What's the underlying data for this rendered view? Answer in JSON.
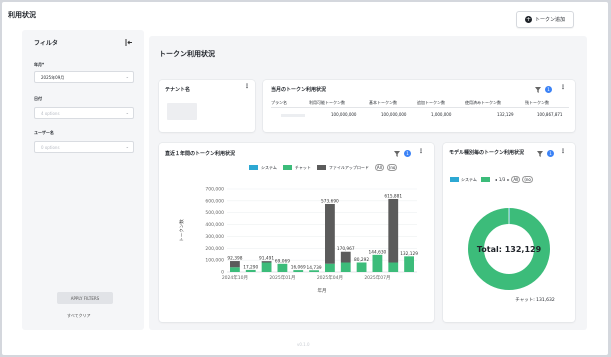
{
  "app": {
    "title": "利用状況",
    "add_token_label": "トークン追加",
    "version": "v0.1.0"
  },
  "filter": {
    "title": "フィルタ",
    "year_month_label": "年月*",
    "year_month_value": "2025年09月",
    "date_label": "日付",
    "date_placeholder": "4 options",
    "user_label": "ユーザー名",
    "user_placeholder": "0 options",
    "apply_label": "APPLY FILTERS",
    "clear_label": "すべてクリア"
  },
  "main": {
    "section_title": "トークン利用状況"
  },
  "tenant": {
    "title": "テナント名"
  },
  "monthly": {
    "title": "当月のトークン利用状況",
    "badge": "1",
    "headers": [
      "プラン名",
      "利用可能トークン数",
      "基本トークン数",
      "追加トークン数",
      "使用済みトークン数",
      "残トークン数"
    ],
    "row": [
      "",
      "100,000,000",
      "100,000,000",
      "1,000,000",
      "132,129",
      "100,867,871"
    ]
  },
  "yearly": {
    "title": "直近１年間のトークン利用状況",
    "badge": "1",
    "legend": [
      "システム",
      "チャット",
      "ファイルアップロード"
    ],
    "all_label": "All",
    "none_label": "(no",
    "ylabel": "トークン数",
    "xlabel": "年月"
  },
  "model": {
    "title": "モデル種別毎のトークン利用状況",
    "badge": "1",
    "legend_system": "システム",
    "pager": "1/3",
    "all_label": "All",
    "none_label": "(no",
    "total_label": "Total: 132,129",
    "slice_label": "チャット: 131,632"
  },
  "colors": {
    "chat": "#3cbc7a",
    "file": "#5b5b5b",
    "system": "#2da8d3",
    "accent": "#3b82f6"
  },
  "chart_data": [
    {
      "type": "bar",
      "title": "直近１年間のトークン利用状況",
      "xlabel": "年月",
      "ylabel": "トークン数",
      "stacked": true,
      "ylim": [
        0,
        700000
      ],
      "yticks": [
        "0",
        "100,000",
        "200,000",
        "300,000",
        "400,000",
        "500,000",
        "600,000",
        "700,000"
      ],
      "xticks": [
        {
          "index": 0,
          "label": "2024年10月"
        },
        {
          "index": 3,
          "label": "2025年01月"
        },
        {
          "index": 6,
          "label": "2025年04月"
        },
        {
          "index": 9,
          "label": "2025年07月"
        }
      ],
      "categories": [
        "2024-10",
        "2024-11",
        "2024-12",
        "2025-01",
        "2025-02",
        "2025-03",
        "2025-04",
        "2025-05",
        "2025-06",
        "2025-07",
        "2025-08",
        "2025-09"
      ],
      "series": [
        {
          "name": "システム",
          "values": [
            0,
            0,
            0,
            0,
            0,
            0,
            0,
            0,
            0,
            0,
            0,
            0
          ]
        },
        {
          "name": "チャット",
          "values": [
            40000,
            17290,
            80000,
            69000,
            16069,
            14739,
            70000,
            80000,
            80292,
            144630,
            80000,
            132129
          ]
        },
        {
          "name": "ファイルアップロード",
          "values": [
            52398,
            0,
            11491,
            0,
            0,
            0,
            503690,
            90967,
            0,
            0,
            535881,
            0
          ]
        }
      ],
      "totals": [
        92398,
        17290,
        91491,
        69069,
        16069,
        14739,
        573690,
        170967,
        80292,
        144630,
        615881,
        132129
      ],
      "labels": [
        "92,398",
        "17,290",
        "91,491",
        "69,069",
        "16,069",
        "14,739",
        "573,690",
        "170,967",
        "80,292",
        "144,630",
        "615,881",
        "132,129"
      ]
    },
    {
      "type": "pie",
      "title": "モデル種別毎のトークン利用状況",
      "donut": true,
      "labels": [
        "チャット",
        "システム"
      ],
      "values": [
        131632,
        497
      ],
      "total_label": "Total: 132,129"
    }
  ]
}
